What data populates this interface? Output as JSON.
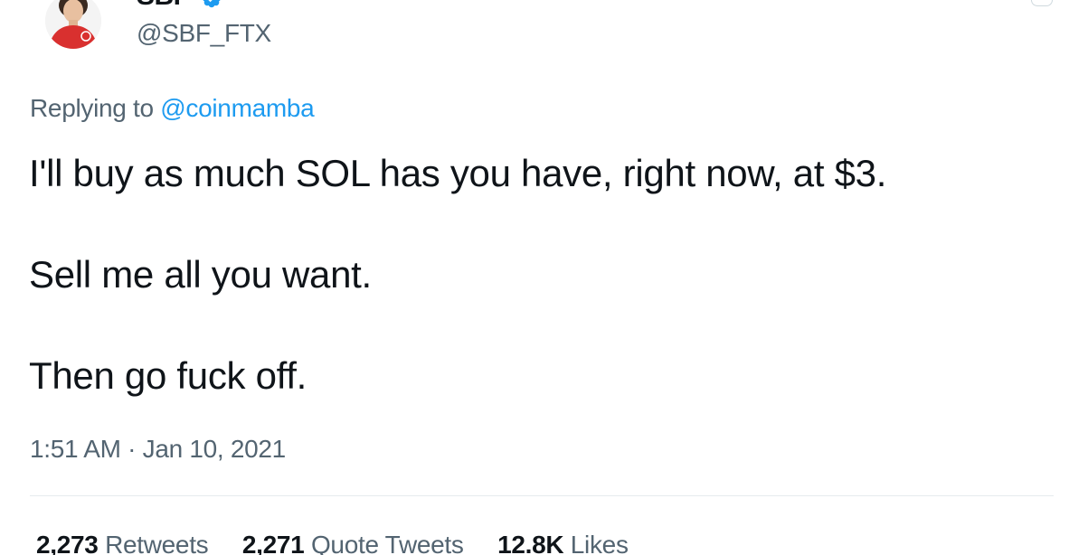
{
  "author": {
    "display_name": "SBF",
    "handle": "@SBF_FTX",
    "verified_icon": "verified-badge-icon",
    "avatar_icon": "avatar-photo"
  },
  "reply": {
    "prefix": "Replying to",
    "mention": "@coinmamba"
  },
  "tweet": {
    "lines": [
      "I'll buy as much SOL has you have, right now, at $3.",
      "Sell me all you want.",
      "Then go fuck off."
    ]
  },
  "meta": {
    "timestamp": "1:51 AM · Jan 10, 2021"
  },
  "stats": {
    "retweets": {
      "count": "2,273",
      "label": "Retweets"
    },
    "quote_tweets": {
      "count": "2,271",
      "label": "Quote Tweets"
    },
    "likes": {
      "count": "12.8K",
      "label": "Likes"
    }
  },
  "colors": {
    "link": "#1d9bf0",
    "secondary_text": "#536471",
    "primary_text": "#0f1419",
    "avatar_shirt": "#d9302f"
  }
}
